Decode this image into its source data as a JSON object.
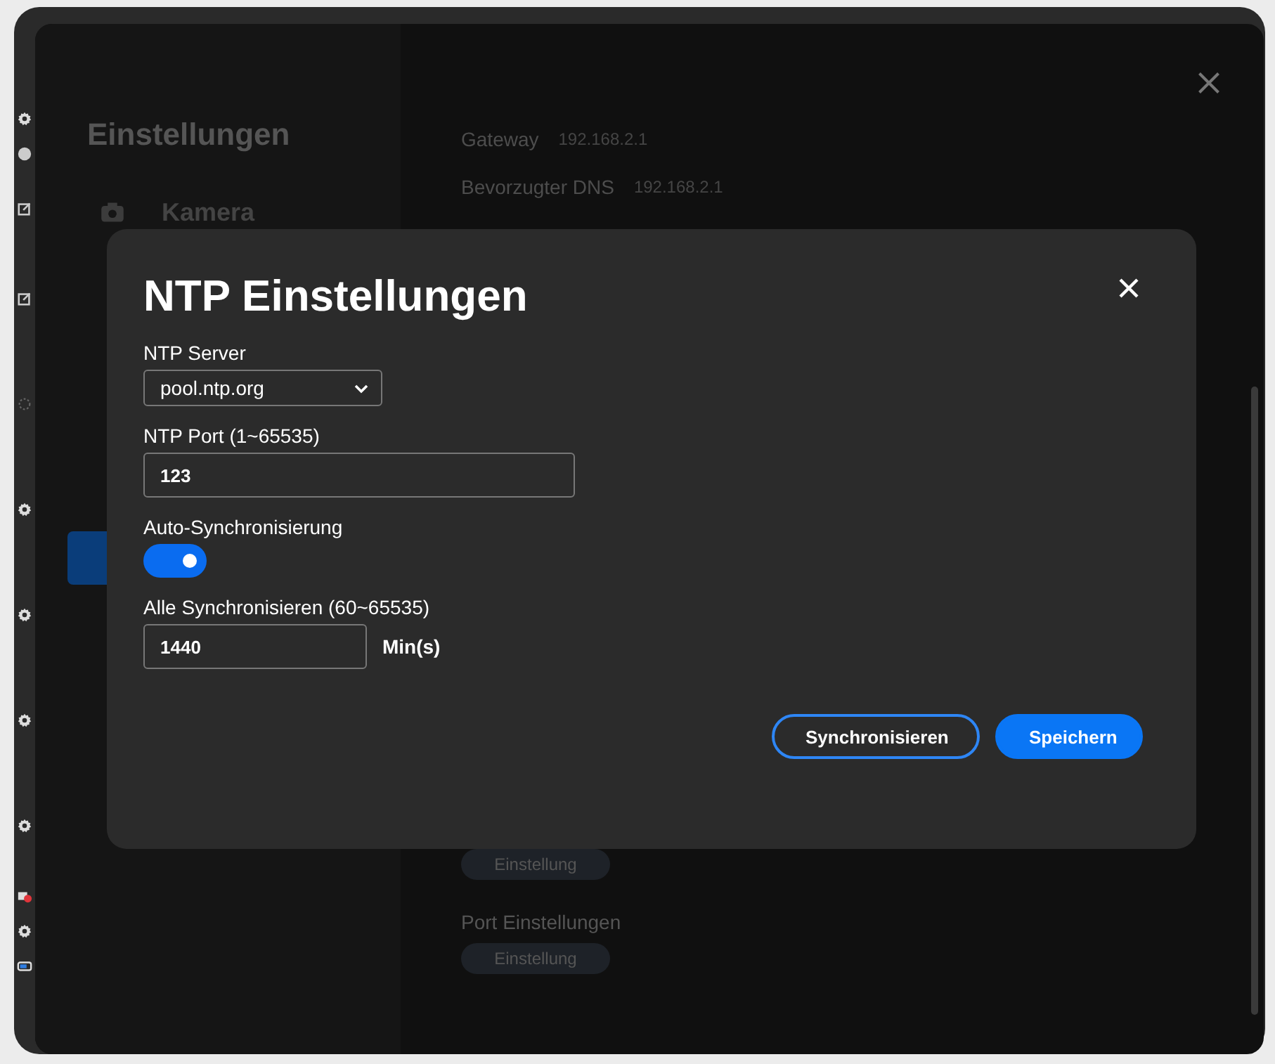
{
  "settings": {
    "title": "Einstellungen",
    "nav_items": [
      {
        "label": "Kamera",
        "selected": false
      },
      {
        "selected": true
      }
    ],
    "network_rows": [
      {
        "label": "Gateway",
        "value": "192.168.2.1"
      },
      {
        "label": "Bevorzugter DNS",
        "value": "192.168.2.1"
      }
    ],
    "sections": [
      {
        "button": "Einstellung"
      },
      {
        "title": "Port Einstellungen",
        "button": "Einstellung"
      }
    ]
  },
  "dialog": {
    "title": "NTP Einstellungen",
    "fields": [
      {
        "kind": "select",
        "label": "NTP Server",
        "value": "pool.ntp.org"
      },
      {
        "kind": "input",
        "label": "NTP Port (1~65535)",
        "value": "123"
      },
      {
        "kind": "toggle",
        "label": "Auto-Synchronisierung",
        "on": true
      },
      {
        "kind": "unit-input",
        "label": "Alle Synchronisieren (60~65535)",
        "value": "1440",
        "unit": "Min(s)"
      }
    ],
    "buttons": [
      {
        "kind": "outline",
        "label": "Synchronisieren"
      },
      {
        "kind": "primary",
        "label": "Speichern"
      }
    ]
  }
}
